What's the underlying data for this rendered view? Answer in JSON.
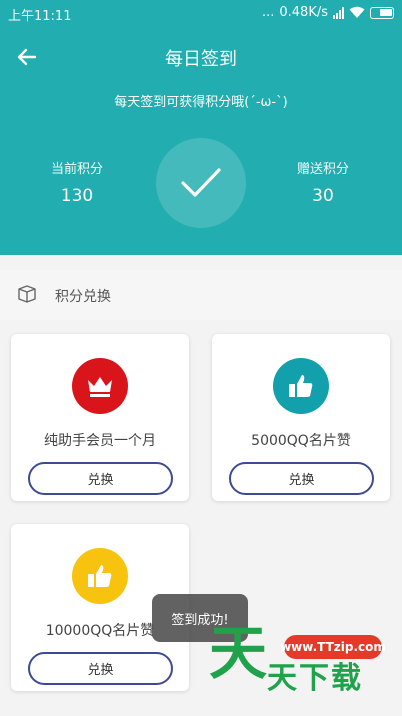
{
  "status_bar": {
    "time": "上午11:11",
    "dots": "...",
    "speed": "0.48K/s"
  },
  "header": {
    "title": "每日签到",
    "subtitle": "每天签到可获得积分哦(´-ω-`)",
    "current_points_label": "当前积分",
    "current_points_value": "130",
    "bonus_points_label": "赠送积分",
    "bonus_points_value": "30"
  },
  "section": {
    "title": "积分兑换"
  },
  "rewards": [
    {
      "name": "纯助手会员一个月",
      "button": "兑换",
      "icon": "crown-icon",
      "color": "#d9151b"
    },
    {
      "name": "5000QQ名片赞",
      "button": "兑换",
      "icon": "thumbs-up-icon",
      "color": "#13a0ad"
    },
    {
      "name": "10000QQ名片赞",
      "button": "兑换",
      "icon": "thumbs-up-icon",
      "color": "#f8c30f"
    }
  ],
  "toast": "签到成功!",
  "watermark": {
    "big": "天",
    "site": "www.TTzip.com",
    "text": "天下载"
  },
  "colors": {
    "header": "#22adb0",
    "button_border": "#3e4a93"
  }
}
